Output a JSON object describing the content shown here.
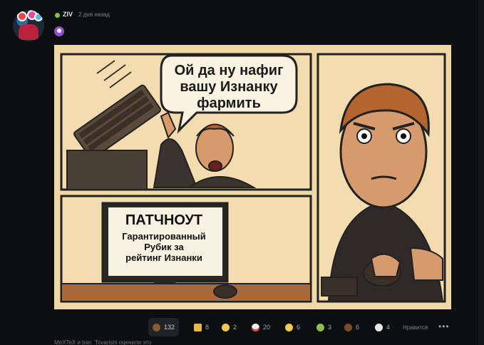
{
  "author": {
    "name": "ZIV",
    "time": "2 дня назад"
  },
  "post": {
    "emoji_icon": "smiling-imp-icon",
    "comic": {
      "bubble_text": "Ой да ну нафиг\nвашу Изнанку\nфармить",
      "monitor_title": "ПАТЧНОУТ",
      "monitor_text": "Гарантированный\nРубик за\nрейтинг Изнанки"
    }
  },
  "reactions": [
    {
      "icon": "poop-icon",
      "count": "132",
      "active": true
    },
    {
      "icon": "thumbs-down-icon",
      "count": "8"
    },
    {
      "icon": "grimace-face-icon",
      "count": "2"
    },
    {
      "icon": "clown-face-icon",
      "count": "20"
    },
    {
      "icon": "neutral-face-icon",
      "count": "6"
    },
    {
      "icon": "nauseated-face-icon",
      "count": "3"
    },
    {
      "icon": "mammoth-icon",
      "count": "6"
    },
    {
      "icon": "skull-icon",
      "count": "4"
    }
  ],
  "actions": {
    "like_label": "Нравится",
    "more_label": "•••"
  },
  "rated_by": "MeXTeX и ban_Tovarishi оценили это",
  "colors": {
    "background": "#0d0e10",
    "comic_bg": "#f0d7a6",
    "online": "#7ac943"
  }
}
